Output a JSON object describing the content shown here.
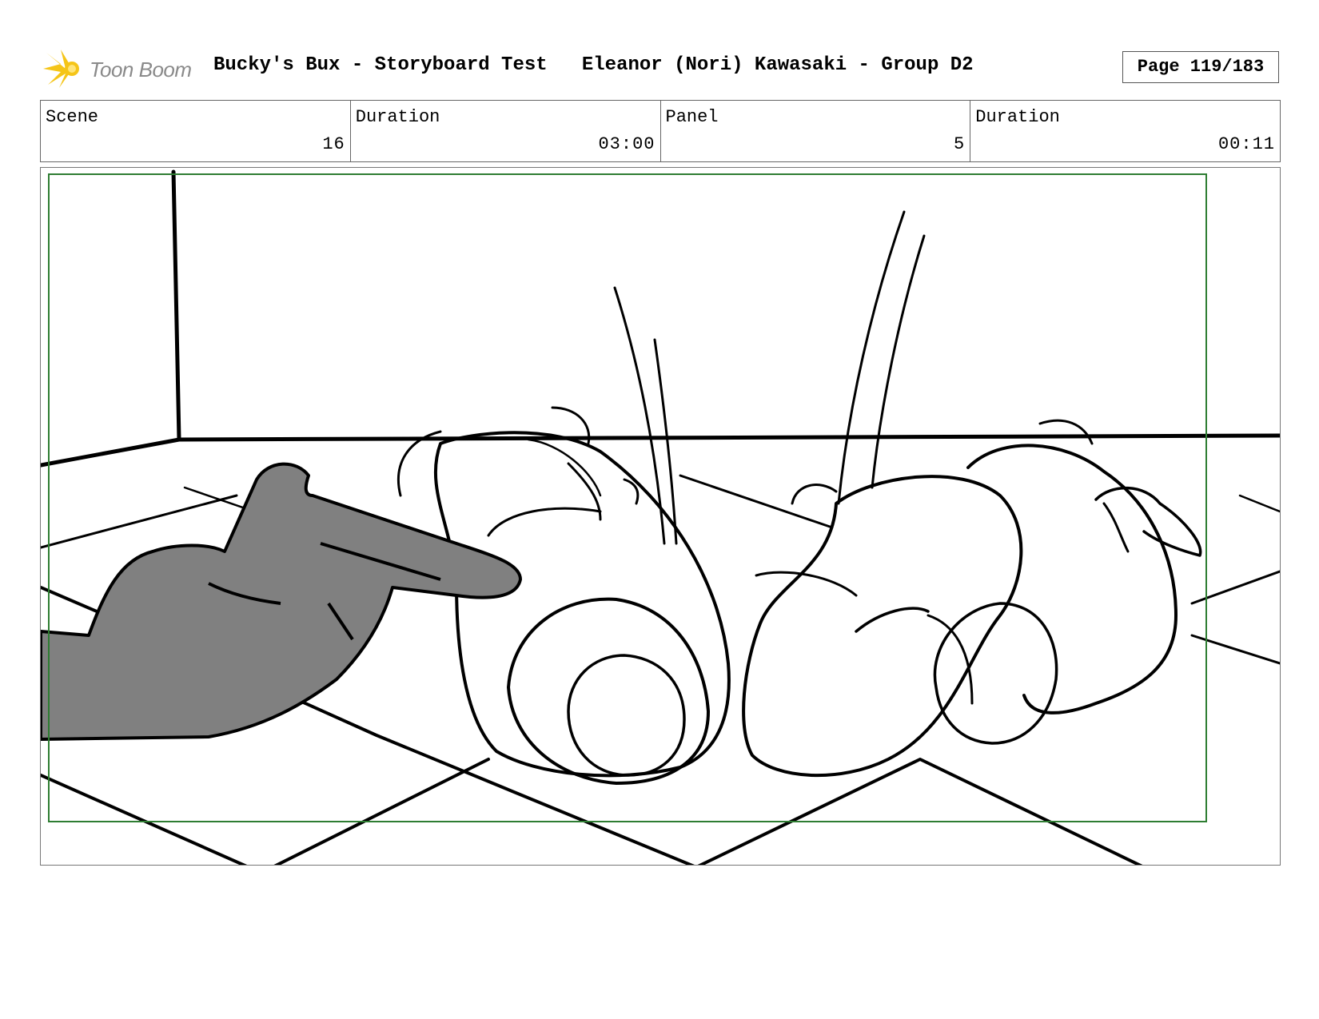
{
  "header": {
    "logo_text": "Toon Boom",
    "title": "Bucky's Bux - Storyboard Test   Eleanor (Nori) Kawasaki - Group D2",
    "page": "Page 119/183"
  },
  "info": {
    "scene_label": "Scene",
    "scene_value": "16",
    "scene_duration_label": "Duration",
    "scene_duration_value": "03:00",
    "panel_label": "Panel",
    "panel_value": "5",
    "panel_duration_label": "Duration",
    "panel_duration_value": "00:11"
  },
  "colors": {
    "logo_star": "#f5c518",
    "safe_frame": "#2e7d32",
    "hand_fill": "#808080"
  }
}
